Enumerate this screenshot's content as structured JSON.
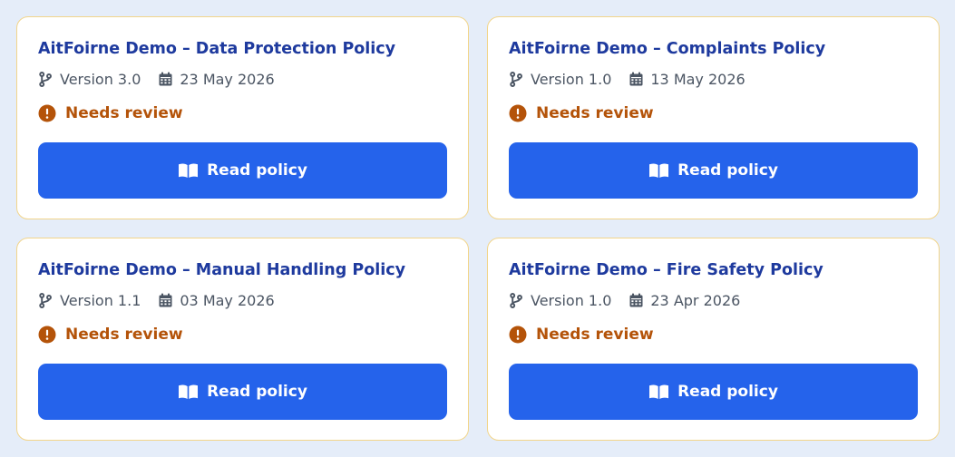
{
  "colors": {
    "page_background": "#e5edf9",
    "card_border": "#f2d58a",
    "title": "#1e3a9e",
    "meta_text": "#4b5563",
    "status_warning": "#b45309",
    "button_primary": "#2563eb"
  },
  "icons": {
    "version": "git-branch-icon",
    "date": "calendar-icon",
    "status": "exclamation-circle-icon",
    "read": "open-book-icon"
  },
  "policies": [
    {
      "title": "AitFoirne Demo – Data Protection Policy",
      "version": "Version 3.0",
      "date": "23 May 2026",
      "status": "Needs review",
      "button_label": "Read policy"
    },
    {
      "title": "AitFoirne Demo – Complaints Policy",
      "version": "Version 1.0",
      "date": "13 May 2026",
      "status": "Needs review",
      "button_label": "Read policy"
    },
    {
      "title": "AitFoirne Demo – Manual Handling Policy",
      "version": "Version 1.1",
      "date": "03 May 2026",
      "status": "Needs review",
      "button_label": "Read policy"
    },
    {
      "title": "AitFoirne Demo – Fire Safety Policy",
      "version": "Version 1.0",
      "date": "23 Apr 2026",
      "status": "Needs review",
      "button_label": "Read policy"
    }
  ]
}
